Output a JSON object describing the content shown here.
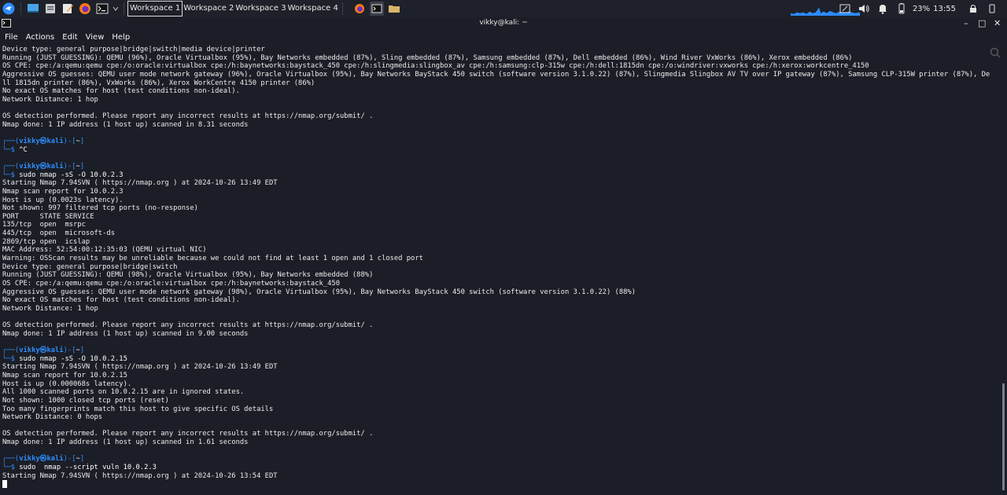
{
  "panel": {
    "workspaces": [
      "Workspace 1",
      "Workspace 2",
      "Workspace 3",
      "Workspace 4"
    ],
    "active_workspace": 0,
    "battery": "23%",
    "clock": "13:55"
  },
  "window": {
    "title": "vikky@kali: ~",
    "minimize": "–",
    "maximize": "□",
    "close": "✕"
  },
  "menubar": [
    "File",
    "Actions",
    "Edit",
    "View",
    "Help"
  ],
  "terminal": {
    "prompt_user": "vikky㉿kali",
    "prompt_dir": "~",
    "blocks": [
      {
        "type": "text",
        "lines": [
          "Device type: general purpose|bridge|switch|media device|printer",
          "Running (JUST GUESSING): QEMU (96%), Oracle Virtualbox (95%), Bay Networks embedded (87%), Sling embedded (87%), Samsung embedded (87%), Dell embedded (86%), Wind River VxWorks (86%), Xerox embedded (86%)",
          "OS CPE: cpe:/a:qemu:qemu cpe:/o:oracle:virtualbox cpe:/h:baynetworks:baystack_450 cpe:/h:slingmedia:slingbox_av cpe:/h:samsung:clp-315w cpe:/h:dell:1815dn cpe:/o:windriver:vxworks cpe:/h:xerox:workcentre_4150",
          "Aggressive OS guesses: QEMU user mode network gateway (96%), Oracle Virtualbox (95%), Bay Networks BayStack 450 switch (software version 3.1.0.22) (87%), Slingmedia Slingbox AV TV over IP gateway (87%), Samsung CLP-315W printer (87%), De",
          "ll 1815dn printer (86%), VxWorks (86%), Xerox WorkCentre 4150 printer (86%)",
          "No exact OS matches for host (test conditions non-ideal).",
          "Network Distance: 1 hop",
          "",
          "OS detection performed. Please report any incorrect results at https://nmap.org/submit/ .",
          "Nmap done: 1 IP address (1 host up) scanned in 8.31 seconds",
          ""
        ]
      },
      {
        "type": "prompt",
        "command": "^C"
      },
      {
        "type": "text",
        "lines": [
          ""
        ]
      },
      {
        "type": "prompt",
        "command": "sudo nmap -sS -O 10.0.2.3"
      },
      {
        "type": "text",
        "lines": [
          "Starting Nmap 7.94SVN ( https://nmap.org ) at 2024-10-26 13:49 EDT",
          "Nmap scan report for 10.0.2.3",
          "Host is up (0.0023s latency).",
          "Not shown: 997 filtered tcp ports (no-response)",
          "PORT     STATE SERVICE",
          "135/tcp  open  msrpc",
          "445/tcp  open  microsoft-ds",
          "2869/tcp open  icslap",
          "MAC Address: 52:54:00:12:35:03 (QEMU virtual NIC)",
          "Warning: OSScan results may be unreliable because we could not find at least 1 open and 1 closed port",
          "Device type: general purpose|bridge|switch",
          "Running (JUST GUESSING): QEMU (98%), Oracle Virtualbox (95%), Bay Networks embedded (88%)",
          "OS CPE: cpe:/a:qemu:qemu cpe:/o:oracle:virtualbox cpe:/h:baynetworks:baystack_450",
          "Aggressive OS guesses: QEMU user mode network gateway (98%), Oracle Virtualbox (95%), Bay Networks BayStack 450 switch (software version 3.1.0.22) (88%)",
          "No exact OS matches for host (test conditions non-ideal).",
          "Network Distance: 1 hop",
          "",
          "OS detection performed. Please report any incorrect results at https://nmap.org/submit/ .",
          "Nmap done: 1 IP address (1 host up) scanned in 9.00 seconds",
          ""
        ]
      },
      {
        "type": "prompt",
        "command": "sudo nmap -sS -O 10.0.2.15"
      },
      {
        "type": "text",
        "lines": [
          "Starting Nmap 7.94SVN ( https://nmap.org ) at 2024-10-26 13:49 EDT",
          "Nmap scan report for 10.0.2.15",
          "Host is up (0.000068s latency).",
          "All 1000 scanned ports on 10.0.2.15 are in ignored states.",
          "Not shown: 1000 closed tcp ports (reset)",
          "Too many fingerprints match this host to give specific OS details",
          "Network Distance: 0 hops",
          "",
          "OS detection performed. Please report any incorrect results at https://nmap.org/submit/ .",
          "Nmap done: 1 IP address (1 host up) scanned in 1.61 seconds",
          ""
        ]
      },
      {
        "type": "prompt",
        "command": "sudo  nmap --script vuln 10.0.2.3"
      },
      {
        "type": "text",
        "lines": [
          "Starting Nmap 7.94SVN ( https://nmap.org ) at 2024-10-26 13:54 EDT"
        ]
      }
    ]
  }
}
